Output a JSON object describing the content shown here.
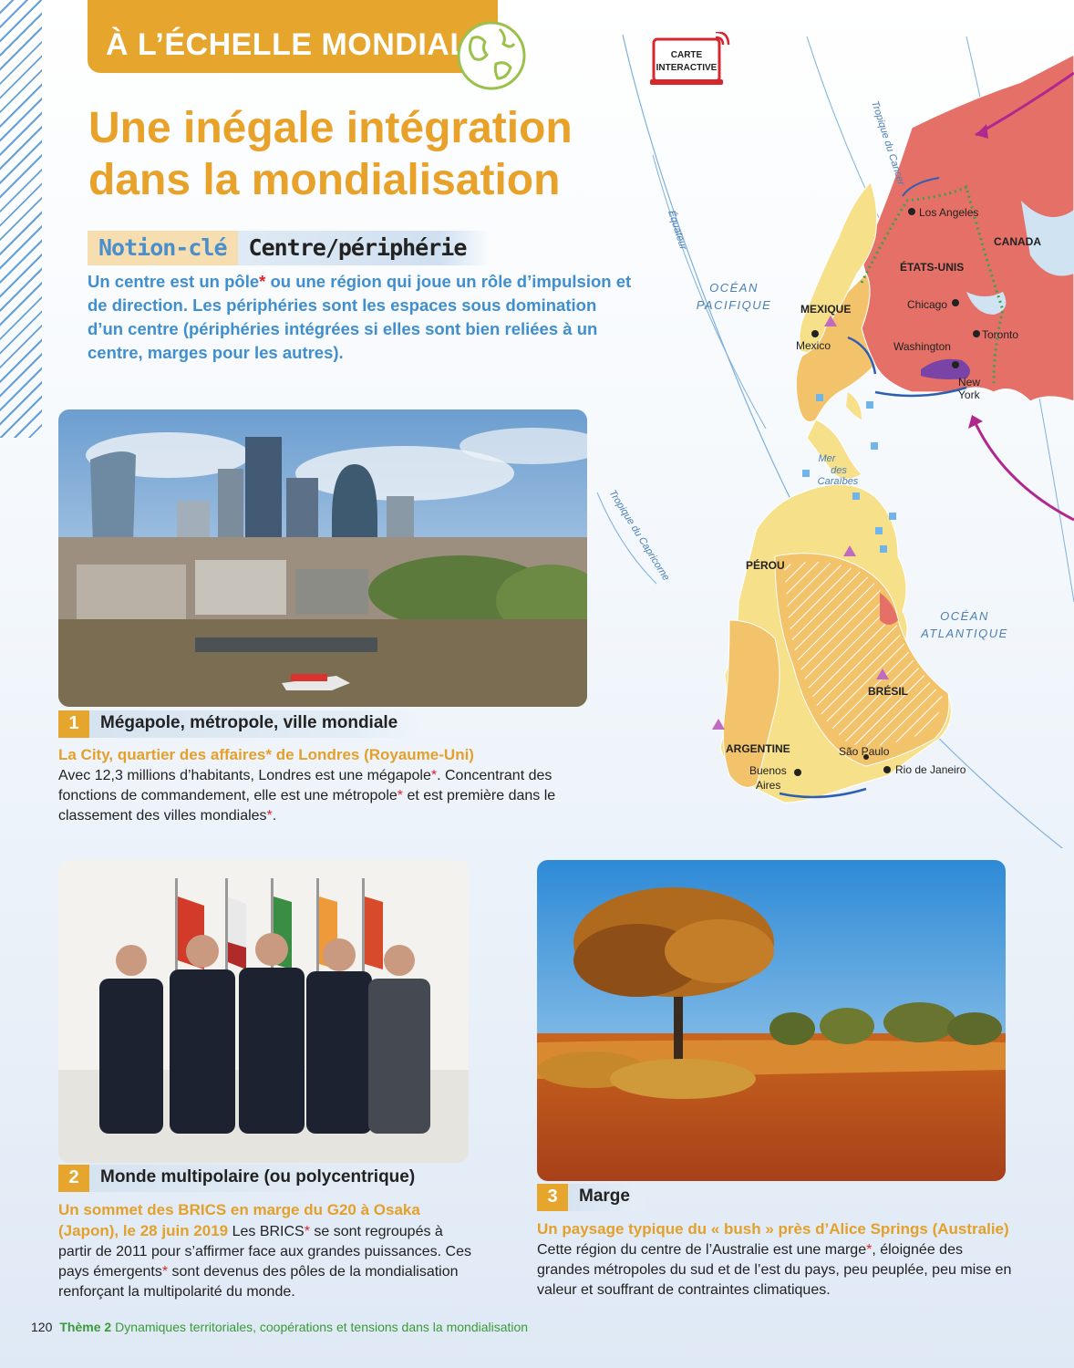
{
  "header": {
    "banner": "À L’ÉCHELLE MONDIALE",
    "title_line1": "Une inégale intégration",
    "title_line2": "dans la mondialisation",
    "interactive_map_line1": "CARTE",
    "interactive_map_line2": "INTERACTIVE"
  },
  "notion": {
    "tag": "Notion-clé",
    "value": "Centre/périphérie",
    "def_part1": "Un centre est un pôle",
    "def_star": "*",
    "def_part2": " ou une région qui joue un rôle d’impulsion et de direction. Les périphéries sont les espaces sous domination d’un centre (périphéries intégrées si elles sont bien reliées à un centre, marges pour les autres)."
  },
  "doc1": {
    "num": "1",
    "title": "Mégapole, métropole, ville mondiale",
    "head": "La City, quartier des affaires",
    "head_end": " de Londres (Royaume-Uni)",
    "t1": "Avec 12,3 millions d’habitants, Londres est une mégapole",
    "t2": ". Concentrant des fonctions de commandement, elle est une métropole",
    "t3": " et est première dans le classement des villes mondiales",
    "t4": "."
  },
  "doc2": {
    "num": "2",
    "title": "Monde multipolaire (ou polycentrique)",
    "head": "Un sommet des BRICS en marge du G20 à Osaka (Japon), le 28 juin 2019",
    "t1": " Les BRICS",
    "t2": " se sont regroupés à partir de 2011 pour s’affirmer face aux grandes puissances. Ces pays émergents",
    "t3": " sont devenus des pôles de la mondialisation renforçant la multipolarité du monde."
  },
  "doc3": {
    "num": "3",
    "title": "Marge",
    "head": "Un paysage typique du « bush » près d’Alice Springs (Australie)",
    "t1": " Cette région du centre de l’Australie est une marge",
    "t2": ", éloignée des grandes métropoles du sud et de l’est du pays, peu peuplée, peu mise en valeur et souffrant de contraintes climatiques."
  },
  "map": {
    "labels": {
      "canada": "CANADA",
      "usa": "ÉTATS-UNIS",
      "los_angeles": "Los Angeles",
      "chicago": "Chicago",
      "toronto": "Toronto",
      "washington": "Washington",
      "new": "New",
      "york": "York",
      "mexique": "MEXIQUE",
      "mexico": "Mexico",
      "mer": "Mer",
      "des": "des",
      "caraibes": "Caraïbes",
      "perou": "PÉROU",
      "bresil": "BRÉSIL",
      "argentine": "ARGENTINE",
      "sao_paulo": "São Paulo",
      "rio": "Rio de Janeiro",
      "buenos": "Buenos",
      "aires": "Aires",
      "oc_pac1": "OCÉAN",
      "oc_pac2": "PACIFIQUE",
      "oc_atl1": "OCÉAN",
      "oc_atl2": "ATLANTIQUE",
      "tropique_cancer": "Tropique du Cancer",
      "equateur": "Équateur",
      "tropique_capricorne": "Tropique du Capricorne"
    }
  },
  "footer": {
    "page": "120",
    "theme": "Thème 2",
    "text": "Dynamiques territoriales, coopérations et tensions dans la mondialisation"
  },
  "colors": {
    "accent_orange": "#e6a52c",
    "accent_blue": "#3f8fd0",
    "asterisk_red": "#d8262d",
    "center_red": "#e57067",
    "periphery_yellow": "#f6e08a",
    "periphery_orange": "#f3c36c"
  }
}
